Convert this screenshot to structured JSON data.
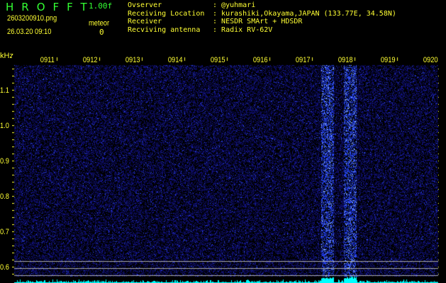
{
  "header": {
    "title": "HROFFT",
    "version": "1.00f",
    "filename": "2603200910.png",
    "datetime": "26.03.20 09:10",
    "meteor_label": "meteor",
    "meteor_count": "0"
  },
  "info": [
    {
      "label": "Ovserver",
      "value": "@yuhmari"
    },
    {
      "label": "Receiving Location",
      "value": "kurashiki,Okayama,JAPAN (133.77E, 34.58N)"
    },
    {
      "label": "Receiver",
      "value": "NESDR SMArt + HDSDR"
    },
    {
      "label": "Recviving antenna",
      "value": "Radix RV-62V"
    }
  ],
  "axis": {
    "unit": "kHz",
    "time_labels": [
      "0911",
      "0912",
      "0913",
      "0914",
      "0915",
      "0916",
      "0917",
      "0918",
      "0919",
      "0920"
    ],
    "freq_labels": [
      "1.1",
      "1.0",
      "0.9",
      "0.8",
      "0.7",
      "0.6"
    ]
  },
  "colors": {
    "text": "#ffff33",
    "title": "#33ff33",
    "noise": "#1a1aa0",
    "signal": "#00ffff"
  }
}
